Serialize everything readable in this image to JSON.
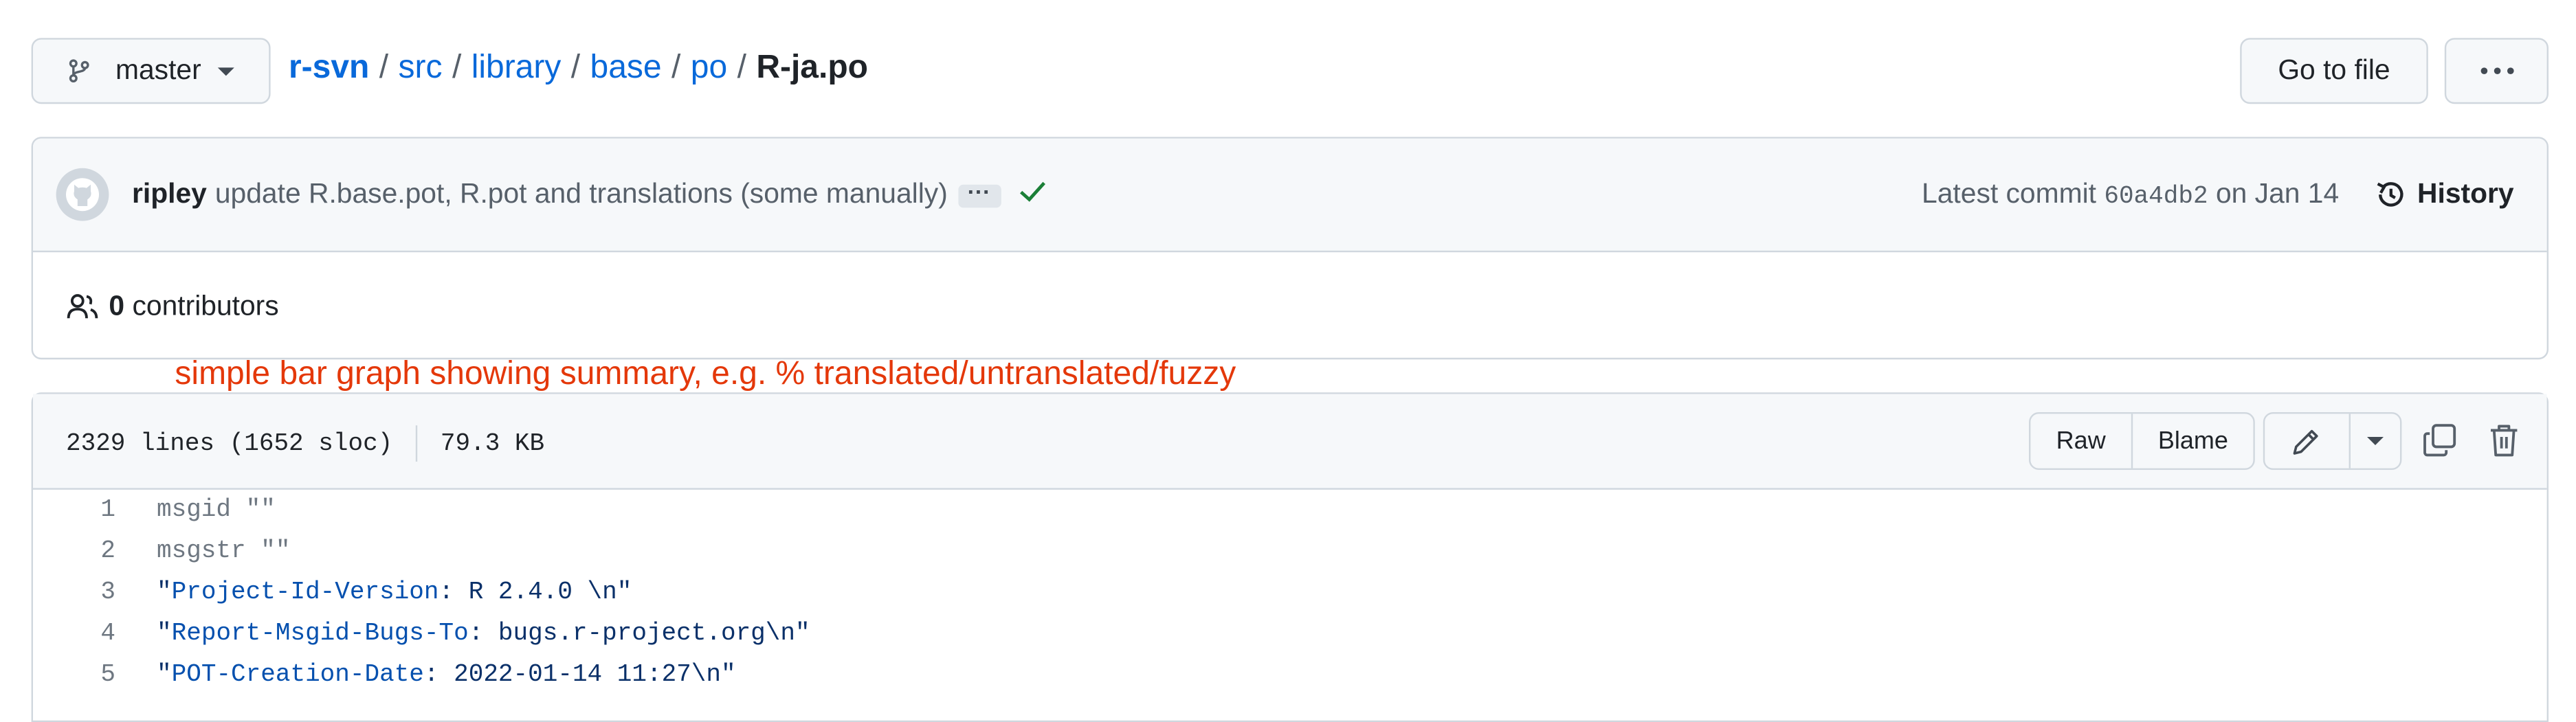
{
  "branch": {
    "name": "master",
    "icon": "git-branch-icon"
  },
  "breadcrumb": {
    "repo": "r-svn",
    "dirs": [
      "src",
      "library",
      "base",
      "po"
    ],
    "file": "R-ja.po",
    "separator": "/"
  },
  "actions": {
    "goto_file": "Go to file",
    "more": "···"
  },
  "commit": {
    "author": "ripley",
    "message": "update R.base.pot, R.pot and translations (some manually)",
    "ellipsis": "···",
    "status": "success",
    "latest_label": "Latest commit",
    "sha": "60a4db2",
    "date_text": "on Jan 14",
    "history": "History"
  },
  "contributors": {
    "count": "0",
    "label": "contributors"
  },
  "annotation": "simple bar graph showing summary, e.g. % translated/untranslated/fuzzy",
  "file": {
    "lines_info": "2329 lines (1652 sloc)",
    "size": "79.3 KB",
    "raw": "Raw",
    "blame": "Blame"
  },
  "code_lines": [
    {
      "num": "1",
      "text": "msgid \"\""
    },
    {
      "num": "2",
      "text": "msgstr \"\""
    },
    {
      "num": "3",
      "q1": "\"",
      "key": "Project-Id-Version",
      "rest": ": R 2.4.0 \\n\""
    },
    {
      "num": "4",
      "q1": "\"",
      "key": "Report-Msgid-Bugs-To",
      "rest": ": bugs.r-project.org\\n\""
    },
    {
      "num": "5",
      "q1": "\"",
      "key": "POT-Creation-Date",
      "rest": ": 2022-01-14 11:27\\n\""
    }
  ],
  "colors": {
    "link": "#0969da",
    "annotation": "#e4380a",
    "success": "#1a7f37"
  }
}
